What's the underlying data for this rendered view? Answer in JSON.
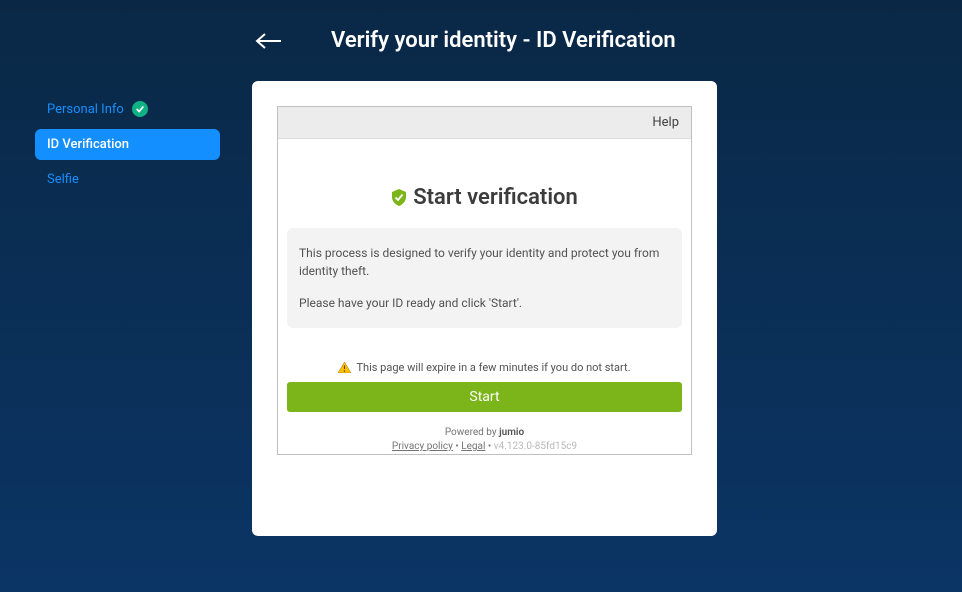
{
  "header": {
    "title": "Verify your identity - ID Verification"
  },
  "sidebar": {
    "items": [
      {
        "label": "Personal Info",
        "status": "completed"
      },
      {
        "label": "ID Verification",
        "status": "active"
      },
      {
        "label": "Selfie",
        "status": "pending"
      }
    ]
  },
  "frame": {
    "help_label": "Help",
    "title": "Start verification",
    "info_line1": "This process is designed to verify your identity and protect you from identity theft.",
    "info_line2": "Please have your ID ready and click 'Start'.",
    "warning_text": "This page will expire in a few minutes if you do not start.",
    "start_label": "Start",
    "footer": {
      "powered_by_prefix": "Powered by ",
      "powered_by_brand": "jumio",
      "privacy_label": "Privacy policy",
      "legal_label": "Legal",
      "version": "v4.123.0-85fd15c9",
      "separator": " • "
    }
  }
}
